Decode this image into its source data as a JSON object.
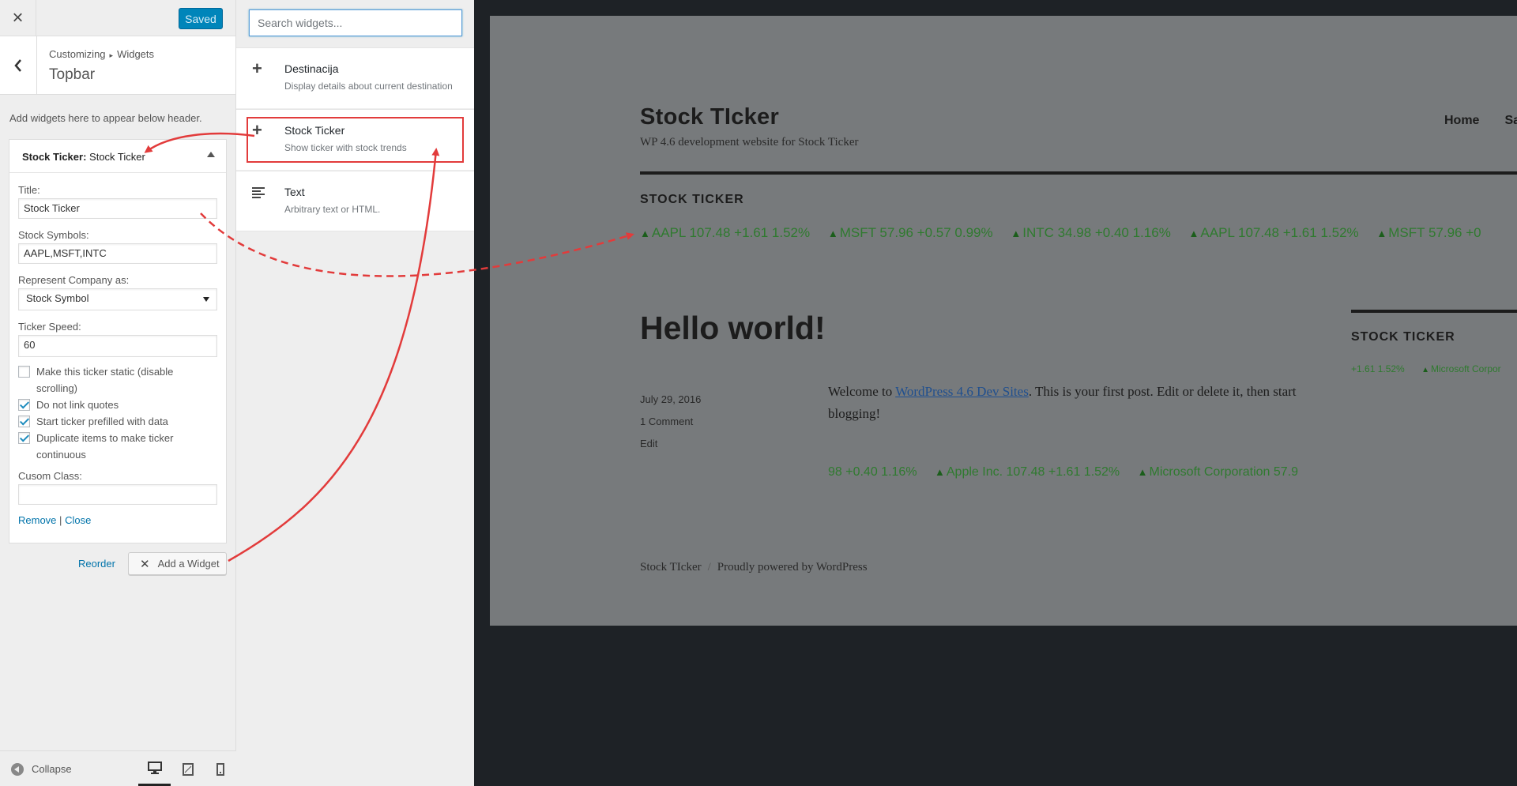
{
  "header": {
    "close_icon": "close-icon",
    "save_label": "Saved"
  },
  "section": {
    "breadcrumb_parent": "Customizing",
    "breadcrumb_child": "Widgets",
    "title": "Topbar",
    "description": "Add widgets here to appear below header."
  },
  "widget": {
    "title_type": "Stock Ticker:",
    "title_name": "Stock Ticker",
    "fields": {
      "title_label": "Title:",
      "title_value": "Stock Ticker",
      "symbols_label": "Stock Symbols:",
      "symbols_value": "AAPL,MSFT,INTC",
      "represent_label": "Represent Company as:",
      "represent_value": "Stock Symbol",
      "speed_label": "Ticker Speed:",
      "speed_value": "60",
      "class_label": "Cusom Class:",
      "class_value": ""
    },
    "checkboxes": [
      {
        "label": "Make this ticker static (disable scrolling)",
        "checked": false
      },
      {
        "label": "Do not link quotes",
        "checked": true
      },
      {
        "label": "Start ticker prefilled with data",
        "checked": true
      },
      {
        "label": "Duplicate items to make ticker continuous",
        "checked": true
      }
    ],
    "remove_label": "Remove",
    "separator": "|",
    "close_label": "Close"
  },
  "actions": {
    "reorder_label": "Reorder",
    "add_widget_label": "Add a Widget"
  },
  "footer": {
    "collapse_label": "Collapse",
    "devices": [
      "desktop-icon",
      "tablet-icon",
      "mobile-icon"
    ]
  },
  "available_widgets": {
    "search_placeholder": "Search widgets...",
    "items": [
      {
        "title": "Destinacija",
        "description": "Display details about current destination",
        "icon": "plus-icon"
      },
      {
        "title": "Stock Ticker",
        "description": "Show ticker with stock trends",
        "icon": "plus-icon"
      },
      {
        "title": "Text",
        "description": "Arbitrary text or HTML.",
        "icon": "text-lines-icon"
      }
    ]
  },
  "preview": {
    "site_title": "Stock TIcker",
    "tagline": "WP 4.6 development website for Stock Ticker",
    "nav": [
      "Home",
      "Sa"
    ],
    "ticker_heading": "STOCK TICKER",
    "ticker_items": [
      "AAPL 107.48 +1.61 1.52%",
      "MSFT 57.96 +0.57 0.99%",
      "INTC 34.98 +0.40 1.16%",
      "AAPL 107.48 +1.61 1.52%",
      "MSFT 57.96 +0"
    ],
    "post_title": "Hello world!",
    "post_date": "July 29, 2016",
    "post_comments": "1 Comment",
    "post_edit": "Edit",
    "post_text_before": "Welcome to ",
    "post_text_link": "WordPress 4.6 Dev Sites",
    "post_text_after": ". This is your first post. Edit or delete it, then start blogging!",
    "post_ticker_lead": "98 +0.40 1.16%",
    "post_ticker_items": [
      "Apple Inc. 107.48 +1.61 1.52%",
      "Microsoft Corporation 57.9"
    ],
    "sidebar_heading": "STOCK TICKER",
    "sidebar_ticker_lead": "+1.61 1.52%",
    "sidebar_ticker_item": "Microsoft Corpor",
    "footer_site": "Stock TIcker",
    "footer_slash": "/",
    "footer_powered": "Proudly powered by WordPress"
  },
  "colors": {
    "accent": "#0085ba",
    "highlight_red": "#e23b3b",
    "ticker_green": "#2f7a2f"
  }
}
